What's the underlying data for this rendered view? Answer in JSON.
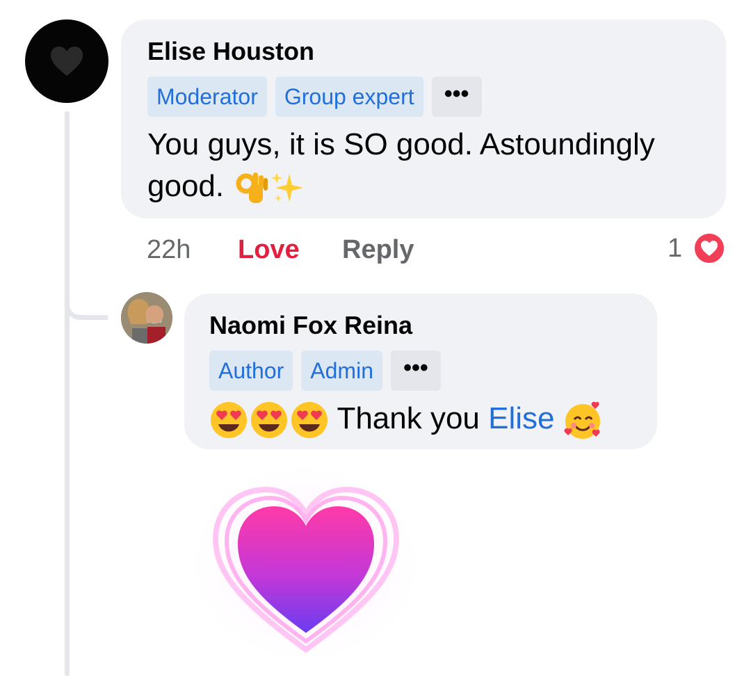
{
  "comment": {
    "author": "Elise Houston",
    "badges": [
      "Moderator",
      "Group expert"
    ],
    "more_label": "•••",
    "text_line1": "You guys, it is SO good. Astoundingly",
    "text_line2": "good.",
    "emojis": [
      "ok-hand-emoji",
      "sparkles-emoji"
    ],
    "time": "22h",
    "love_label": "Love",
    "reply_label": "Reply",
    "reaction_count": "1",
    "reaction_type": "heart-icon"
  },
  "reply": {
    "author": "Naomi Fox Reina",
    "badges": [
      "Author",
      "Admin"
    ],
    "more_label": "•••",
    "leading_emojis": [
      "heart-eyes-emoji",
      "heart-eyes-emoji",
      "heart-eyes-emoji"
    ],
    "text": "Thank you",
    "mention": "Elise",
    "trailing_emoji": "smiling-face-with-hearts-emoji"
  },
  "colors": {
    "accent_blue": "#216fdb",
    "love_red": "#e41e3f",
    "bubble_bg": "#f0f2f5",
    "badge_bg": "#dbe7f2"
  }
}
